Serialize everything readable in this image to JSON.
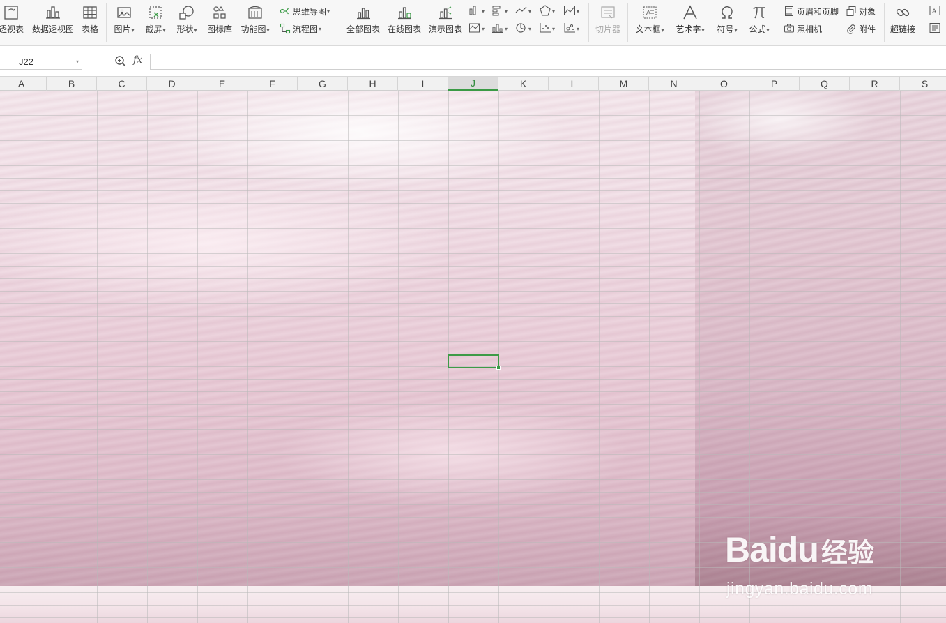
{
  "ribbon": {
    "pivot_table": "透视表",
    "pivot_chart": "数据透视图",
    "table": "表格",
    "picture": "图片",
    "screenshot": "截屏",
    "shapes": "形状",
    "icon_library": "图标库",
    "function_chart": "功能图",
    "mind_map": "思维导图",
    "flowchart": "流程图",
    "all_charts": "全部图表",
    "online_charts": "在线图表",
    "demo_charts": "演示图表",
    "slicer": "切片器",
    "textbox": "文本框",
    "wordart": "艺术字",
    "symbol": "符号",
    "formula": "公式",
    "header_footer": "页眉和页脚",
    "object": "对象",
    "camera": "照相机",
    "attachment": "附件",
    "hyperlink": "超链接"
  },
  "formula_bar": {
    "cell_reference": "J22",
    "fx_label": "fx",
    "formula_value": ""
  },
  "columns": [
    "A",
    "B",
    "C",
    "D",
    "E",
    "F",
    "G",
    "H",
    "I",
    "J",
    "K",
    "L",
    "M",
    "N",
    "O",
    "P",
    "Q",
    "R",
    "S"
  ],
  "active_column": "J",
  "active_cell": "J22",
  "colors": {
    "selection": "#3d9b47",
    "ribbon_bg": "#f7f7f7",
    "background_tint": "#e7c8d4"
  },
  "watermark": {
    "brand": "Baidu",
    "brand_cn": "经验",
    "url": "jingyan.baidu.com"
  }
}
